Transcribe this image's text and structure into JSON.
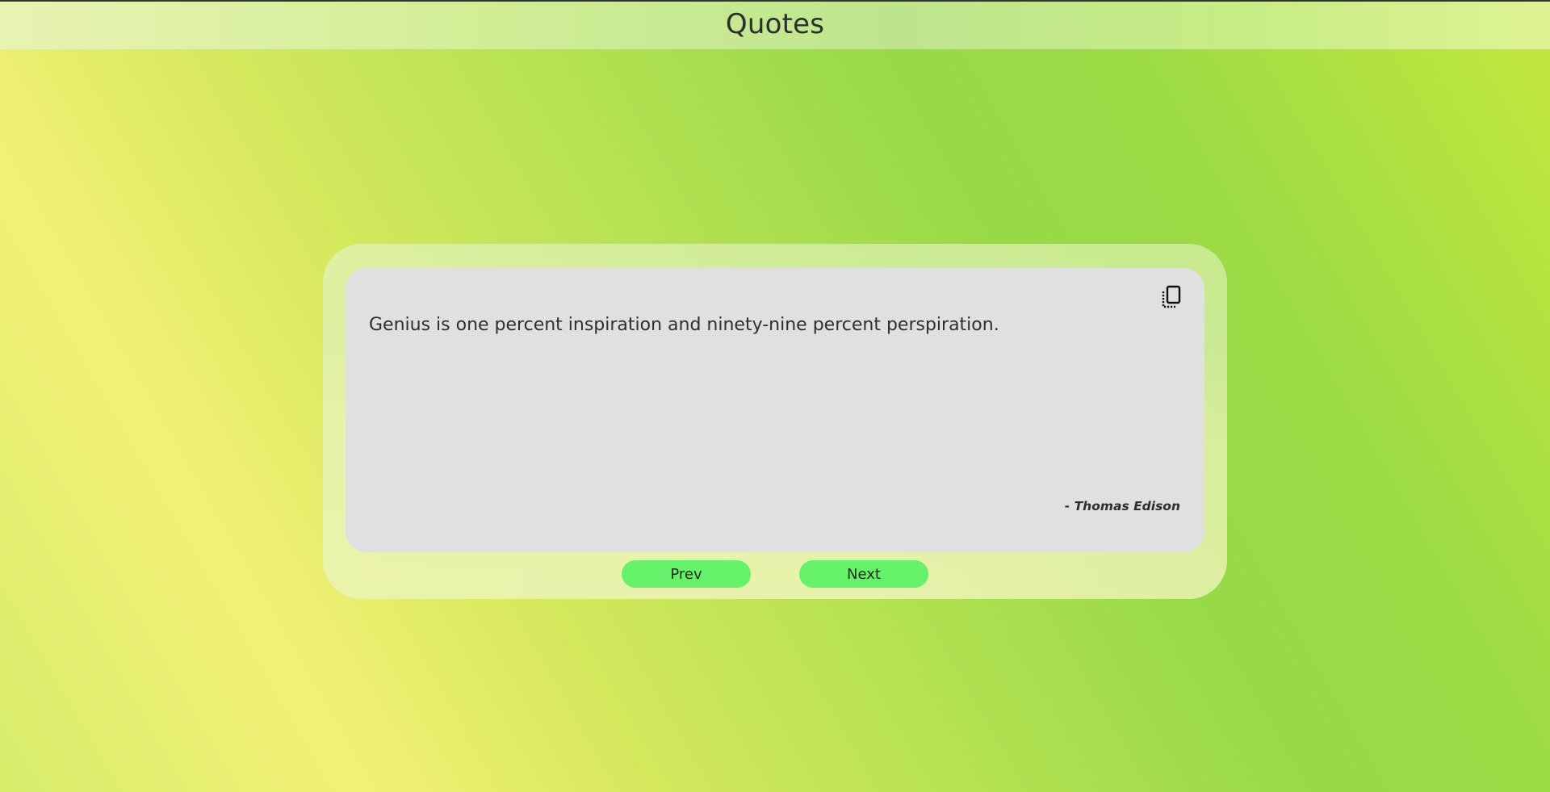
{
  "header": {
    "title": "Quotes"
  },
  "quote": {
    "text": "Genius is one percent inspiration and ninety-nine percent perspiration.",
    "author": "- Thomas Edison",
    "copy_icon": "copy-icon"
  },
  "controls": {
    "prev_label": "Prev",
    "next_label": "Next"
  },
  "colors": {
    "button": "#65f26a",
    "quote_box": "#e0e0e0",
    "text": "#2d2d2d"
  }
}
